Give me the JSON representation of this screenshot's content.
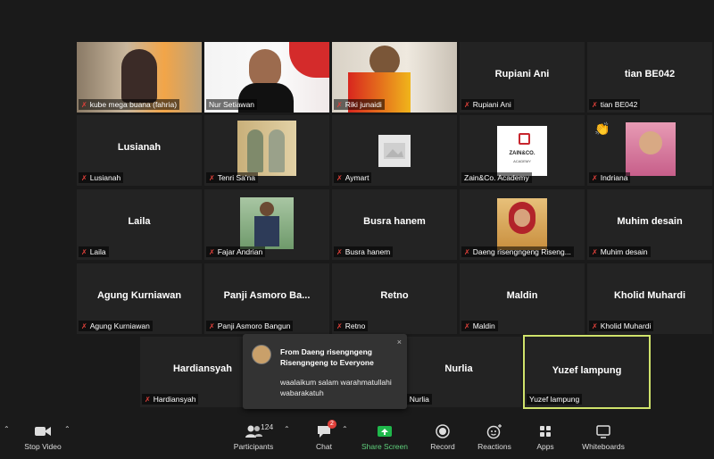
{
  "tiles": {
    "kube": {
      "label": "kube mega buana (fahria)"
    },
    "nur": {
      "label": "Nur Setiawan"
    },
    "riki": {
      "label": "Riki junaidi"
    },
    "rupiani": {
      "name": "Rupiani Ani",
      "label": "Rupiani Ani"
    },
    "tian": {
      "name": "tian BE042",
      "label": "tian BE042"
    },
    "lusianah": {
      "name": "Lusianah",
      "label": "Lusianah"
    },
    "tenri": {
      "label": "Tenri Sa'na"
    },
    "aymart": {
      "label": "Aymart"
    },
    "zain": {
      "label": "Zain&Co. Academy",
      "logo_text": "ZAIN&CO.",
      "logo_sub": "ACADEMY"
    },
    "indriana": {
      "label": "Indriana"
    },
    "laila": {
      "name": "Laila",
      "label": "Laila"
    },
    "fajar": {
      "label": "Fajar Andrian"
    },
    "busra": {
      "name": "Busra hanem",
      "label": "Busra hanem"
    },
    "daeng": {
      "label": "Daeng risengngeng Riseng..."
    },
    "muhim": {
      "name": "Muhim desain",
      "label": "Muhim desain"
    },
    "agung": {
      "name": "Agung Kurniawan",
      "label": "Agung Kurniawan"
    },
    "panji": {
      "name": "Panji Asmoro Ba...",
      "label": "Panji Asmoro Bangun"
    },
    "retno": {
      "name": "Retno",
      "label": "Retno"
    },
    "maldin": {
      "name": "Maldin",
      "label": "Maldin"
    },
    "kholid": {
      "name": "Kholid Muhardi",
      "label": "Kholid Muhardi"
    },
    "hardiansyah": {
      "name": "Hardiansyah",
      "label": "Hardiansyah"
    },
    "nurlia": {
      "name": "Nurlia",
      "label": "Nurlia"
    },
    "yuzef": {
      "name": "Yuzef lampung",
      "label": "Yuzef lampung"
    }
  },
  "chat_popup": {
    "from": "From Daeng risengngeng Risengngeng to Everyone",
    "message": "waalaikum salam warahmatullahi wabarakatuh",
    "close": "×"
  },
  "toolbar": {
    "stop_video": "Stop Video",
    "participants": "Participants",
    "participants_count": "124",
    "chat": "Chat",
    "chat_badge": "2",
    "share_screen": "Share Screen",
    "record": "Record",
    "reactions": "Reactions",
    "apps": "Apps",
    "whiteboards": "Whiteboards"
  },
  "colors": {
    "background": "#1a1a1a",
    "tile": "#232323",
    "mic_muted": "#e0403a",
    "active_speaker": "#cfe26b",
    "share_green": "#1fb84b",
    "badge_red": "#e0403a"
  }
}
